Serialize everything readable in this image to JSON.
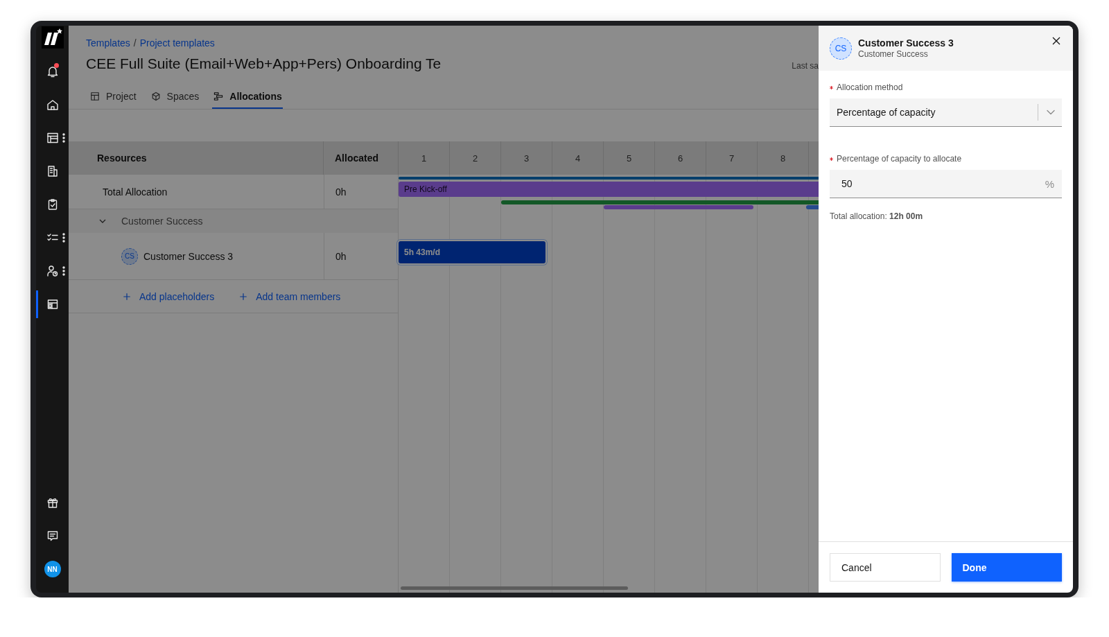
{
  "sidebar": {
    "items": [
      {
        "kind": "bell",
        "selected": false,
        "unread": true,
        "more": false
      },
      {
        "kind": "home",
        "selected": false,
        "unread": false,
        "more": false
      },
      {
        "kind": "calendar",
        "selected": false,
        "unread": false,
        "more": true
      },
      {
        "kind": "building",
        "selected": false,
        "unread": false,
        "more": false
      },
      {
        "kind": "clipboard",
        "selected": false,
        "unread": false,
        "more": false
      },
      {
        "kind": "checklist",
        "selected": false,
        "unread": false,
        "more": true
      },
      {
        "kind": "person",
        "selected": false,
        "unread": false,
        "more": true
      },
      {
        "kind": "layout",
        "selected": true,
        "unread": false,
        "more": false
      }
    ],
    "bottom": [
      {
        "kind": "gift"
      },
      {
        "kind": "chat"
      }
    ],
    "avatar": "NN"
  },
  "breadcrumb": {
    "items": [
      "Templates",
      "Project templates"
    ],
    "separator": "/"
  },
  "title": "CEE Full Suite (Email+Web+App+Pers) Onboarding Te",
  "last_saved": "Last sa",
  "tabs": [
    {
      "label": "Project",
      "kind": "project",
      "selected": false
    },
    {
      "label": "Spaces",
      "kind": "spaces",
      "selected": false
    },
    {
      "label": "Allocations",
      "kind": "allocations",
      "selected": true
    }
  ],
  "grid": {
    "columns": [
      "Resources",
      "Allocated"
    ],
    "weeks": [
      "1",
      "2",
      "3",
      "4",
      "5",
      "6",
      "7",
      "8"
    ],
    "rows": [
      {
        "kind": "total",
        "name": "Total Allocation",
        "allocated": "0h",
        "phase": "Pre Kick-off"
      },
      {
        "kind": "group",
        "name": "Customer Success",
        "expanded": true,
        "children": [
          {
            "kind": "member",
            "initials": "CS",
            "name": "Customer Success 3",
            "allocated": "0h",
            "allocation": "5h 43m/d"
          }
        ]
      }
    ],
    "actions": [
      "Add placeholders",
      "Add team members"
    ]
  },
  "panel": {
    "initials": "CS",
    "name": "Customer Success 3",
    "subtitle": "Customer Success",
    "fields": [
      {
        "kind": "select",
        "label": "Allocation method",
        "required": true,
        "value": "Percentage of capacity"
      },
      {
        "kind": "number",
        "label": "Percentage of capacity to allocate",
        "required": true,
        "value": "50",
        "suffix": "%"
      }
    ],
    "hint": "Total allocation: **12h 00m**",
    "buttons": [
      {
        "label": "Cancel",
        "kind": "secondary"
      },
      {
        "label": "Done",
        "kind": "primary"
      }
    ]
  }
}
